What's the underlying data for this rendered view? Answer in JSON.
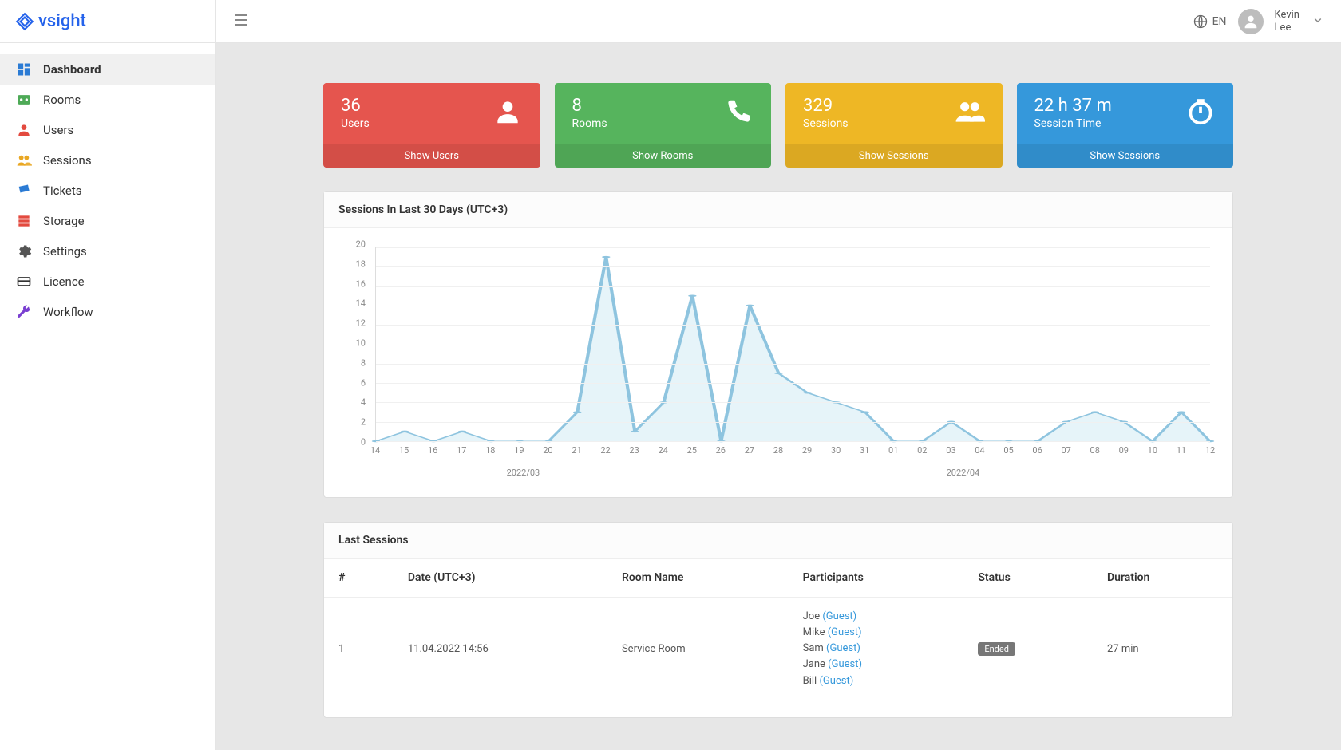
{
  "brand": "vsight",
  "header": {
    "language": "EN",
    "user_first": "Kevin",
    "user_last": "Lee"
  },
  "sidebar": {
    "items": [
      {
        "label": "Dashboard",
        "icon": "dashboard",
        "color": "#2b7bd4",
        "active": true
      },
      {
        "label": "Rooms",
        "icon": "room",
        "color": "#4eaa57",
        "active": false
      },
      {
        "label": "Users",
        "icon": "user",
        "color": "#e34a3f",
        "active": false
      },
      {
        "label": "Sessions",
        "icon": "sessions",
        "color": "#e9a723",
        "active": false
      },
      {
        "label": "Tickets",
        "icon": "ticket",
        "color": "#2b7bd4",
        "active": false
      },
      {
        "label": "Storage",
        "icon": "storage",
        "color": "#e34a3f",
        "active": false
      },
      {
        "label": "Settings",
        "icon": "gear",
        "color": "#555",
        "active": false
      },
      {
        "label": "Licence",
        "icon": "licence",
        "color": "#333",
        "active": false
      },
      {
        "label": "Workflow",
        "icon": "wrench",
        "color": "#7a3fd1",
        "active": false
      }
    ]
  },
  "cards": [
    {
      "value": "36",
      "label": "Users",
      "foot": "Show Users",
      "color": "red",
      "icon": "person"
    },
    {
      "value": "8",
      "label": "Rooms",
      "foot": "Show Rooms",
      "color": "green",
      "icon": "phone"
    },
    {
      "value": "329",
      "label": "Sessions",
      "foot": "Show Sessions",
      "color": "yellow",
      "icon": "people"
    },
    {
      "value": "22 h 37 m",
      "label": "Session Time",
      "foot": "Show Sessions",
      "color": "blue",
      "icon": "timer"
    }
  ],
  "chart_panel_title": "Sessions In Last 30 Days (UTC+3)",
  "chart_data": {
    "type": "line",
    "categories": [
      "14",
      "15",
      "16",
      "17",
      "18",
      "19",
      "20",
      "21",
      "22",
      "23",
      "24",
      "25",
      "26",
      "27",
      "28",
      "29",
      "30",
      "31",
      "01",
      "02",
      "03",
      "04",
      "05",
      "06",
      "07",
      "08",
      "09",
      "10",
      "11",
      "12"
    ],
    "values": [
      0,
      1,
      0,
      1,
      0,
      0,
      0,
      3,
      19,
      1,
      4,
      15,
      0,
      14,
      7,
      5,
      4,
      3,
      0,
      0,
      2,
      0,
      0,
      0,
      2,
      3,
      2,
      0,
      3,
      0
    ],
    "ylim": [
      0,
      20
    ],
    "yticks": [
      0,
      2,
      4,
      6,
      8,
      10,
      12,
      14,
      16,
      18,
      20
    ],
    "month_labels": [
      "2022/03",
      "2022/04"
    ],
    "xlabel": "",
    "ylabel": "",
    "title": "Sessions In Last 30 Days (UTC+3)"
  },
  "last_sessions": {
    "title": "Last Sessions",
    "columns": [
      "#",
      "Date (UTC+3)",
      "Room Name",
      "Participants",
      "Status",
      "Duration"
    ],
    "rows": [
      {
        "num": "1",
        "date": "11.04.2022 14:56",
        "room": "Service Room",
        "participants": [
          {
            "name": "Joe",
            "tag": "(Guest)"
          },
          {
            "name": "Mike",
            "tag": "(Guest)"
          },
          {
            "name": "Sam",
            "tag": "(Guest)"
          },
          {
            "name": "Jane",
            "tag": "(Guest)"
          },
          {
            "name": "Bill",
            "tag": "(Guest)"
          }
        ],
        "status": "Ended",
        "duration": "27 min"
      }
    ]
  }
}
